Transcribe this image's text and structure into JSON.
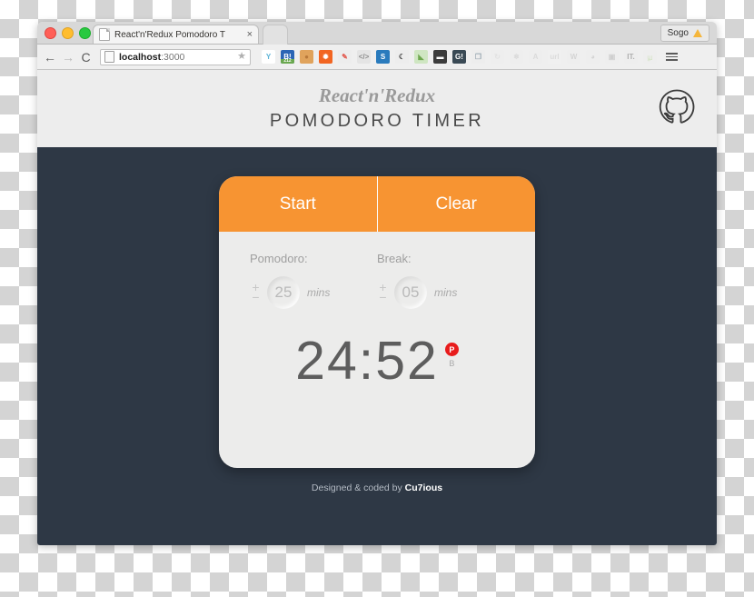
{
  "browser": {
    "tab": {
      "title": "React'n'Redux Pomodoro T",
      "favicon_icon": "page-icon",
      "close_icon": "×"
    },
    "profile_button": {
      "label": "Sogo",
      "icon": "warning-triangle-icon"
    },
    "toolbar": {
      "back_icon": "←",
      "forward_icon": "→",
      "reload_icon": "C",
      "omnibox": {
        "host": "localhost",
        "port": ":3000",
        "page_icon": "page-icon",
        "bookmark_icon": "★"
      },
      "menu_icon": "hamburger-menu-icon",
      "extensions": [
        {
          "name": "yandex-extension-icon",
          "glyph": "Y",
          "bg": "#ffffff",
          "fg": "#5ab2d6"
        },
        {
          "name": "hatena-bookmark-icon",
          "glyph": "B!",
          "bg": "#2b65b5",
          "fg": "#ffffff",
          "badge": "212"
        },
        {
          "name": "cookie-extension-icon",
          "glyph": "●",
          "bg": "#e0a35c",
          "fg": "#b9793a"
        },
        {
          "name": "octotree-icon",
          "glyph": "✹",
          "bg": "#f26522",
          "fg": "#ffffff"
        },
        {
          "name": "marker-pen-icon",
          "glyph": "✎",
          "bg": "#ededed",
          "fg": "#e2574c"
        },
        {
          "name": "code-view-icon",
          "glyph": "</>",
          "bg": "#e4e4e4",
          "fg": "#8d8d8d"
        },
        {
          "name": "sourcegraph-icon",
          "glyph": "S",
          "bg": "#2a7bbd",
          "fg": "#ffffff"
        },
        {
          "name": "moon-reader-icon",
          "glyph": "☾",
          "bg": "#ededed",
          "fg": "#3d3d3d"
        },
        {
          "name": "map-pin-icon",
          "glyph": "◣",
          "bg": "#cfe6c2",
          "fg": "#6fa84f"
        },
        {
          "name": "incognito-mask-icon",
          "glyph": "▬",
          "bg": "#3c3c3c",
          "fg": "#ffffff"
        },
        {
          "name": "grammarly-icon",
          "glyph": "G!",
          "bg": "#3a4a55",
          "fg": "#ffffff"
        },
        {
          "name": "pocket-book-icon",
          "glyph": "❐",
          "bg": "#ededed",
          "fg": "#9aa8b2"
        },
        {
          "name": "refresh-icon",
          "glyph": "↻",
          "bg": "#ededed",
          "fg": "#c8c8c8"
        },
        {
          "name": "react-devtools-icon",
          "glyph": "⚛",
          "bg": "#ededed",
          "fg": "#a8a8a8"
        },
        {
          "name": "adblock-icon",
          "glyph": "A",
          "bg": "#ededed",
          "fg": "#b0b0b0"
        },
        {
          "name": "url-shortener-icon",
          "glyph": "url",
          "bg": "#f4f4f4",
          "fg": "#b5b5b5"
        },
        {
          "name": "wikipedia-icon",
          "glyph": "W",
          "bg": "#ededed",
          "fg": "#9e9e9e"
        },
        {
          "name": "timer-clock-icon",
          "glyph": "◕",
          "bg": "#ededed",
          "fg": "#9e9e9e"
        },
        {
          "name": "screenshot-camera-icon",
          "glyph": "▣",
          "bg": "#ededed",
          "fg": "#8f8f8f"
        },
        {
          "name": "instapaper-icon",
          "glyph": "IT.",
          "bg": "#ededed",
          "fg": "#2b2b2b"
        },
        {
          "name": "evernote-icon",
          "glyph": "௶",
          "bg": "#ededed",
          "fg": "#86c34a"
        }
      ]
    }
  },
  "app": {
    "header": {
      "brand": "React'n'Redux",
      "title": "POMODORO TIMER",
      "github_icon": "github-octocat-icon"
    },
    "actions": {
      "start_label": "Start",
      "clear_label": "Clear"
    },
    "settings": [
      {
        "label": "Pomodoro:",
        "value": "25",
        "unit": "mins",
        "increment_icon": "+",
        "decrement_icon": "−"
      },
      {
        "label": "Break:",
        "value": "05",
        "unit": "mins",
        "increment_icon": "+",
        "decrement_icon": "−"
      }
    ],
    "clock": {
      "time": "24:52",
      "active_flag": "P",
      "inactive_flag": "B"
    },
    "footer": {
      "credit_prefix": "Designed & coded by ",
      "author": "Cu7ious"
    },
    "colors": {
      "accent": "#f79432",
      "background": "#2e3845",
      "card": "#ececeb",
      "active_flag": "#e81c1c"
    }
  }
}
